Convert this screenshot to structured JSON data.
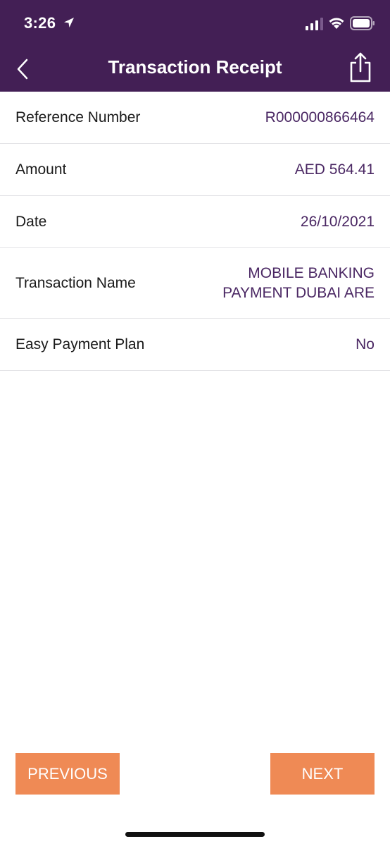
{
  "status_bar": {
    "time": "3:26",
    "icons": [
      "location-arrow-icon",
      "signal-icon",
      "wifi-icon",
      "battery-icon"
    ]
  },
  "nav": {
    "title": "Transaction Receipt",
    "back_icon": "chevron-left-icon",
    "share_icon": "share-icon"
  },
  "details": [
    {
      "label": "Reference Number",
      "value": "R000000866464"
    },
    {
      "label": "Amount",
      "value": "AED 564.41"
    },
    {
      "label": "Date",
      "value": "26/10/2021"
    },
    {
      "label": "Transaction Name",
      "value": "MOBILE BANKING\nPAYMENT DUBAI ARE"
    },
    {
      "label": "Easy Payment Plan",
      "value": "No"
    }
  ],
  "buttons": {
    "previous": "PREVIOUS",
    "next": "NEXT"
  },
  "colors": {
    "header_bg": "#431f55",
    "value_text": "#4a2763",
    "button_bg": "#ef8a55"
  }
}
